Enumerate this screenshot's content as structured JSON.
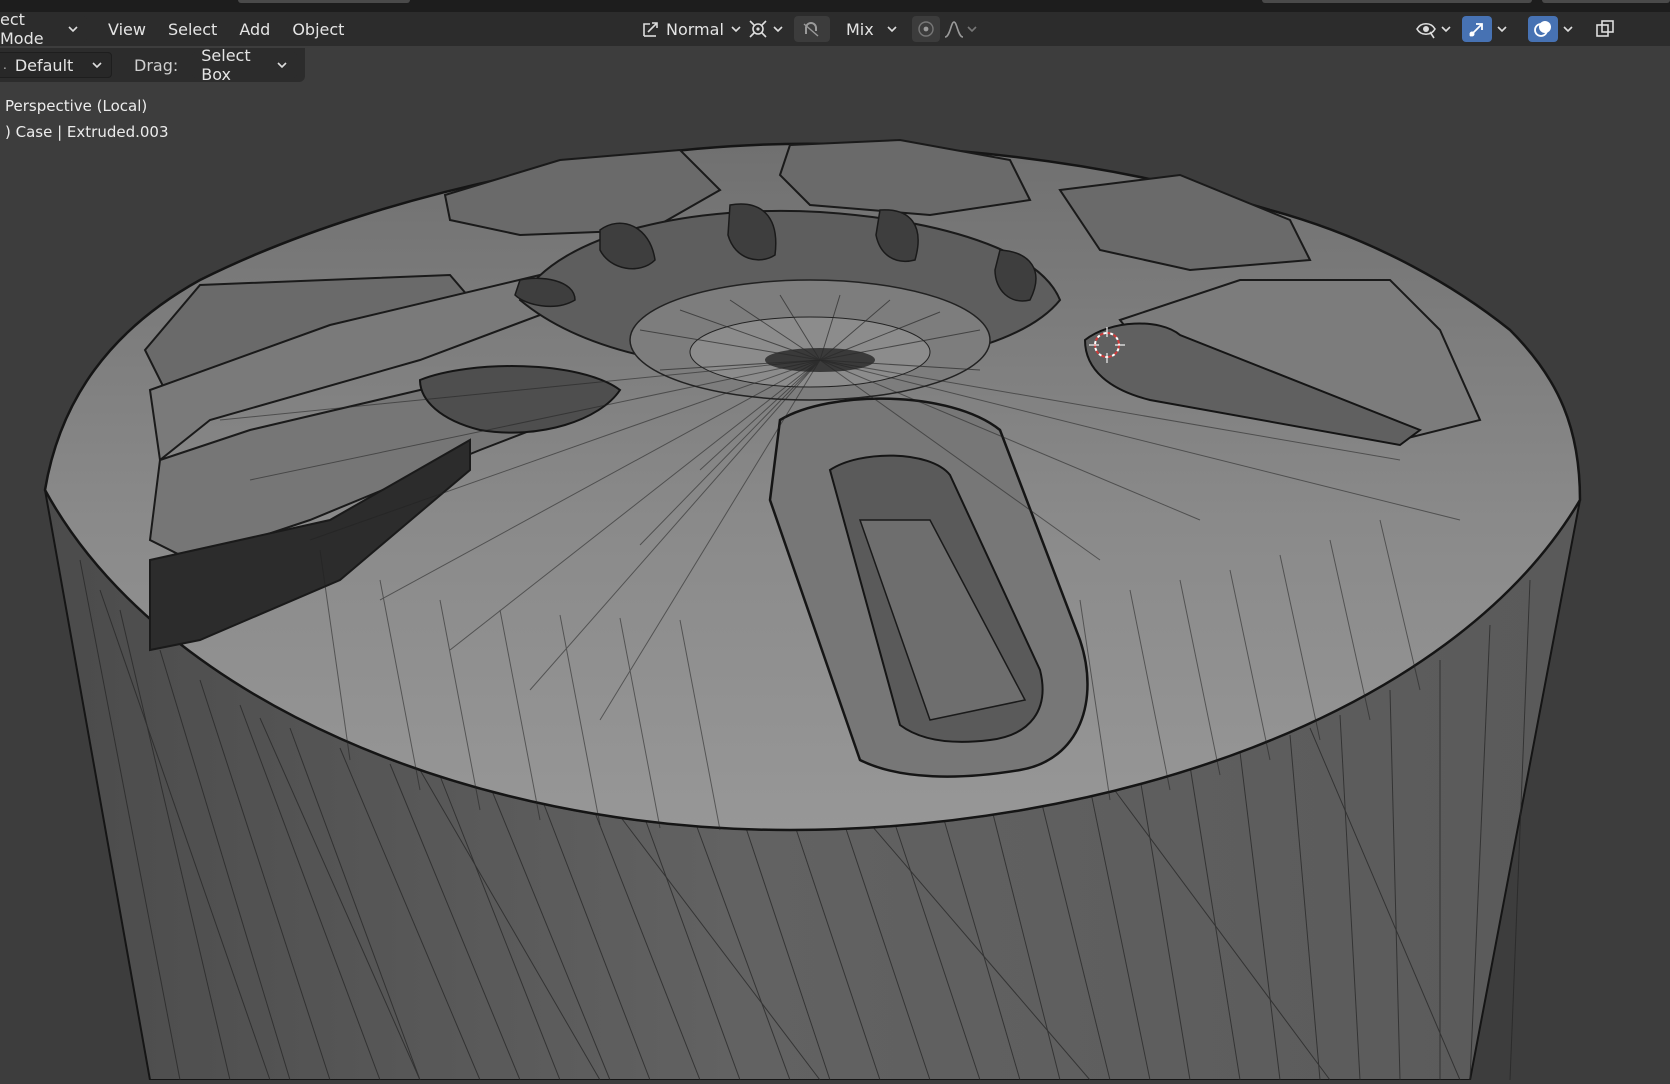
{
  "header": {
    "mode_label": "ect Mode",
    "menus": [
      "View",
      "Select",
      "Add",
      "Object"
    ],
    "transform_orientation": "Normal",
    "snap_label": "Mix"
  },
  "tool_settings": {
    "preset": "Default",
    "drag_label": "Drag:",
    "drag_value": "Select Box"
  },
  "viewport": {
    "view_name": "Perspective (Local)",
    "object_info": ") Case | Extruded.003"
  },
  "colors": {
    "header_bg": "#2c2c2c",
    "viewport_bg": "#3d3d3d",
    "active_icon": "#4772b3",
    "mesh_surface": "#8a8a8a",
    "cursor_red": "#d23c3c"
  }
}
